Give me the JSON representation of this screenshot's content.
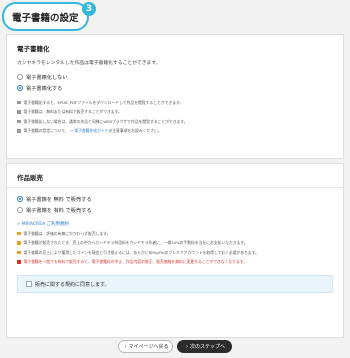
{
  "page": {
    "title": "電子書籍の設定",
    "step_number": "3"
  },
  "ebook_section": {
    "title": "電子書籍化",
    "description": "カシヤキラをレンタルした作品は電子書籍化することができます。",
    "options": [
      {
        "label": "電子書籍化しない",
        "checked": false
      },
      {
        "label": "電子書籍化する",
        "checked": true
      }
    ],
    "notes": [
      "電子書籍化すると、EPUB, PDFファイルをダウンロードして作品を閲覧することができます。",
      "電子書籍は、無料または有料で販売することができます。",
      "電子書籍化しない場合は、通常の作品と同様にWEBブラウザで作品を閲覧することができます。"
    ],
    "guide_note_prefix": "電子書籍の設定について、",
    "guide_link": "電子書籍作成ガイド",
    "guide_note_suffix": "の注意事項をお読みください。"
  },
  "sales_section": {
    "title": "作品販売",
    "options": [
      {
        "label": "電子書籍を 無料 で販売する",
        "checked": true
      },
      {
        "label": "電子書籍を 有料 で販売する",
        "checked": false
      }
    ],
    "terms_link": "MIRACREA ご利用規約",
    "notes": [
      "電子書籍は、評価の有無にかかわらず販売します。",
      "電子書籍が販売されたとき、売上の中からカシヤキラ利用料をカシヤキラ作者に、一律20%の手数料を当社にお支払いただきます。",
      "電子書籍の売上により獲得したコインを現金と引き換えるには、あらかじめPayPalのプレミアアカウントを取得しておく必要があります。"
    ],
    "warning": "電子書籍を一度でも有料で販売すると、電子書籍化の中止、作品内容の修正、販売価格を無料に変更することができなくなります。",
    "agree_label": "販売に関する規約に同意します。"
  },
  "buttons": {
    "back": "マイページへ戻る",
    "next": "次のステップへ"
  }
}
